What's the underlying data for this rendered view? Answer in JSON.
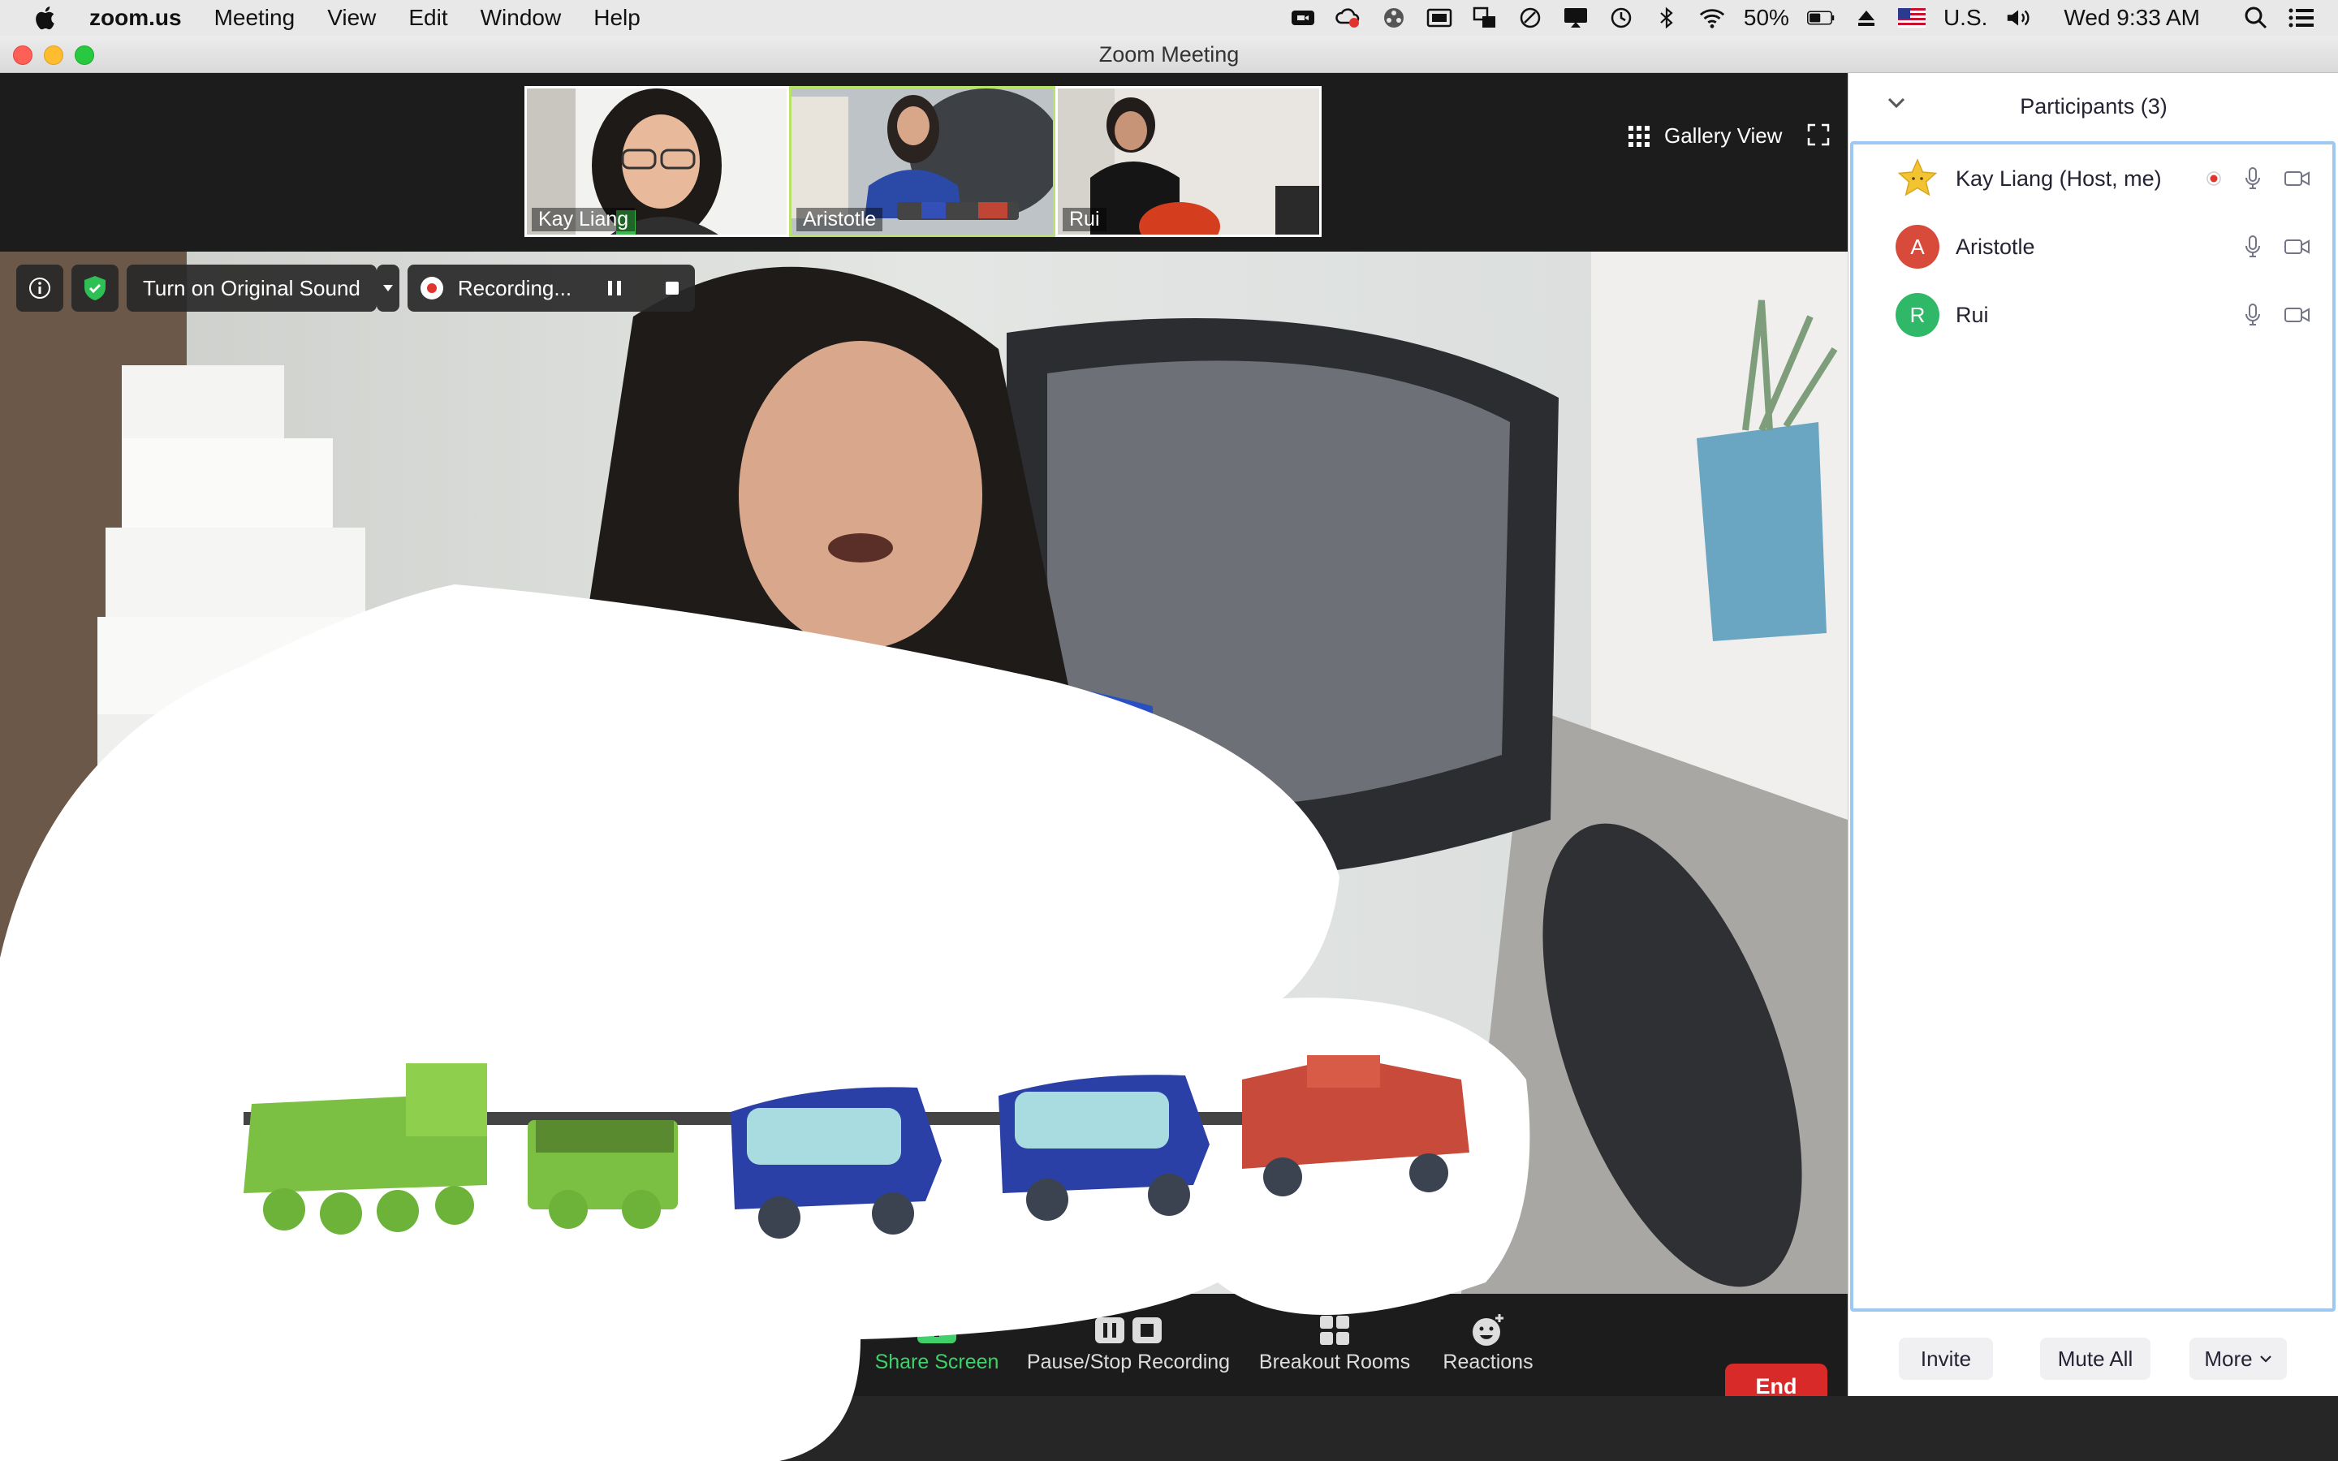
{
  "menubar": {
    "app_name": "zoom.us",
    "menus": [
      "Meeting",
      "View",
      "Edit",
      "Window",
      "Help"
    ],
    "battery": "50%",
    "input_source": "U.S.",
    "clock": "Wed 9:33 AM"
  },
  "window": {
    "title": "Zoom Meeting"
  },
  "gallery": {
    "thumbnails": [
      {
        "name": "Kay Liang"
      },
      {
        "name": "Aristotle"
      },
      {
        "name": "Rui"
      }
    ],
    "view_label": "Gallery View"
  },
  "meeting_topbar": {
    "original_sound_label": "Turn on Original Sound",
    "recording_label": "Recording..."
  },
  "toolbar": {
    "share_screen": "Share Screen",
    "pause_stop_recording": "Pause/Stop Recording",
    "breakout_rooms": "Breakout Rooms",
    "reactions": "Reactions",
    "end": "End"
  },
  "participants": {
    "title": "Participants (3)",
    "list": [
      {
        "name": "Kay Liang (Host, me)",
        "avatar": "star",
        "recording": true
      },
      {
        "name": "Aristotle",
        "avatar": "A",
        "avatar_color": "#d84b3b"
      },
      {
        "name": "Rui",
        "avatar": "R",
        "avatar_color": "#2fb868"
      }
    ],
    "footer": {
      "invite": "Invite",
      "mute_all": "Mute All",
      "more": "More"
    }
  },
  "colors": {
    "accent_green": "#3fd06a",
    "end_red": "#d92a2a",
    "panel_highlight": "#9cc8f2"
  }
}
